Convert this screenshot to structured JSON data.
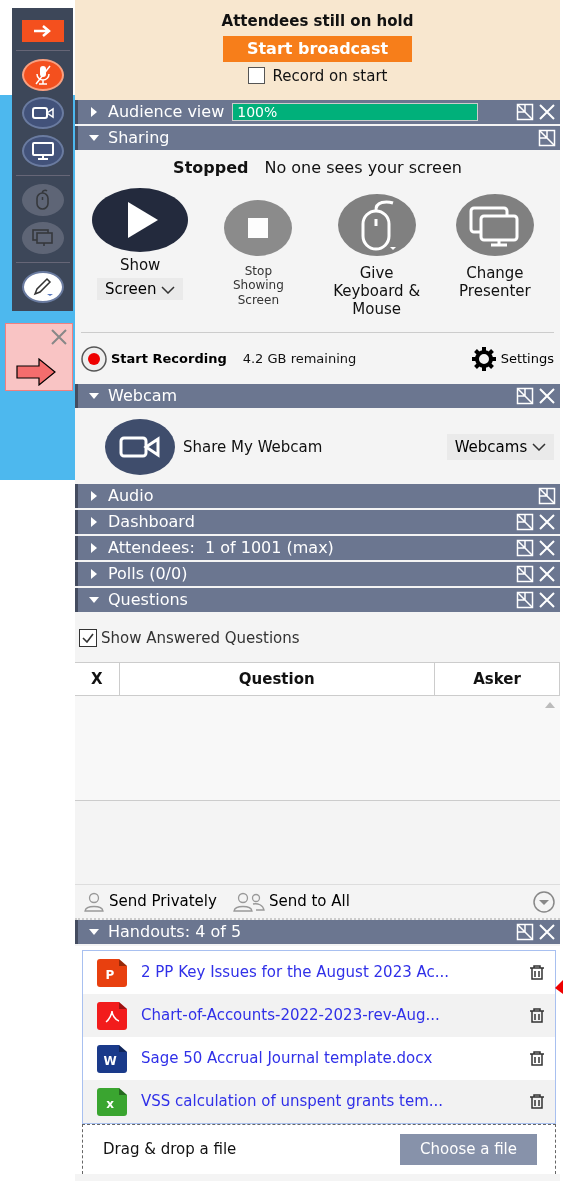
{
  "toolbar": [
    {
      "kind": "collapse",
      "disabled": false
    },
    {
      "kind": "mic-muted",
      "disabled": false
    },
    {
      "kind": "webcam",
      "disabled": false
    },
    {
      "kind": "screen",
      "disabled": false
    },
    {
      "kind": "mouse",
      "disabled": true
    },
    {
      "kind": "screens",
      "disabled": true
    },
    {
      "kind": "pen",
      "disabled": false
    }
  ],
  "hold": {
    "title": "Attendees still on hold",
    "button": "Start broadcast",
    "record": {
      "label": "Record on start",
      "checked": false
    }
  },
  "panels": [
    {
      "kind": "audience",
      "title": "Audience view",
      "expanded": false,
      "closable": true,
      "meter": {
        "level": 1,
        "reading": "100%"
      }
    },
    {
      "kind": "sharing",
      "title": "Sharing",
      "expanded": true,
      "closable": false
    },
    {
      "kind": "webcam",
      "title": "Webcam",
      "expanded": true,
      "closable": true
    },
    {
      "kind": "audio",
      "title": "Audio",
      "expanded": false,
      "closable": false
    },
    {
      "kind": "dashboard",
      "title": "Dashboard",
      "expanded": false,
      "closable": true
    },
    {
      "kind": "attendees",
      "title": "Attendees:  1 of 1001 (max)",
      "expanded": false,
      "closable": true
    },
    {
      "kind": "polls",
      "title": "Polls (0/0)",
      "expanded": false,
      "closable": true
    },
    {
      "kind": "questions",
      "title": "Questions",
      "expanded": true,
      "closable": true
    },
    {
      "kind": "handouts",
      "title": "Handouts: 4 of 5",
      "expanded": true,
      "closable": true
    }
  ],
  "sharing": {
    "status": "Stopped",
    "message": "No one sees your screen",
    "actions": [
      {
        "kind": "show",
        "label": "Show",
        "dropdown": "Screen",
        "disabled": false
      },
      {
        "kind": "stop",
        "label": "Stop Showing Screen",
        "disabled": true
      },
      {
        "kind": "mouse",
        "label": "Give Keyboard & Mouse",
        "disabled": false
      },
      {
        "kind": "presenter",
        "label": "Change Presenter",
        "disabled": false
      }
    ],
    "record": "Start Recording",
    "remaining": "4.2 GB remaining",
    "settings": "Settings"
  },
  "webcam": {
    "label": "Share My Webcam",
    "dropdown": "Webcams"
  },
  "questions": {
    "show_answered": {
      "label": "Show Answered Questions",
      "checked": true
    },
    "columns": [
      "X",
      "Question",
      "Asker"
    ],
    "send_privately": "Send Privately",
    "send_all": "Send to All"
  },
  "handouts": {
    "files": [
      {
        "kind": "powerpoint",
        "letter": "P",
        "name": "2 PP Key Issues for the August 2023 Ac..."
      },
      {
        "kind": "pdf",
        "name": "Chart-of-Accounts-2022-2023-rev-Aug..."
      },
      {
        "kind": "word",
        "letter": "W",
        "name": "Sage 50 Accrual Journal template.docx"
      },
      {
        "kind": "excel",
        "letter": "x",
        "name": "VSS calculation of unspent grants tem..."
      }
    ],
    "drop": "Drag & drop a file",
    "choose": "Choose a file"
  }
}
